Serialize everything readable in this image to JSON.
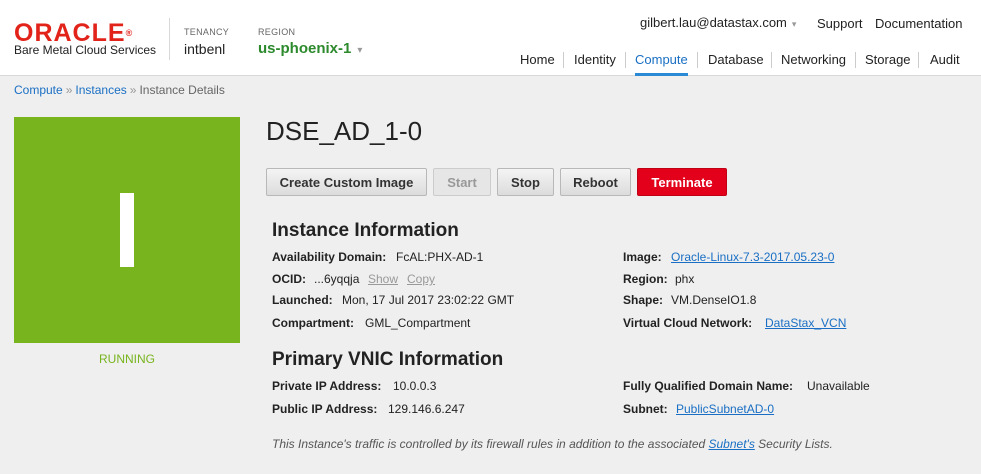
{
  "header": {
    "logo_word": "ORACLE",
    "logo_reg": "®",
    "logo_sub": "Bare Metal Cloud Services",
    "tenancy_caption": "TENANCY",
    "tenancy_value": "intbenl",
    "region_caption": "REGION",
    "region_value": "us-phoenix-1",
    "region_caret": "▾",
    "user": "gilbert.lau@datastax.com",
    "user_caret": "▾",
    "links": {
      "support": "Support",
      "documentation": "Documentation"
    },
    "nav": {
      "home": "Home",
      "identity": "Identity",
      "compute": "Compute",
      "database": "Database",
      "networking": "Networking",
      "storage": "Storage",
      "audit": "Audit"
    }
  },
  "breadcrumb": {
    "compute": "Compute",
    "instances": "Instances",
    "current": "Instance Details",
    "sep": "»"
  },
  "status": {
    "letter": "I",
    "text": "RUNNING",
    "color": "#78b41e"
  },
  "instance": {
    "title": "DSE_AD_1-0"
  },
  "actions": {
    "create_image": "Create Custom Image",
    "start": "Start",
    "stop": "Stop",
    "reboot": "Reboot",
    "terminate": "Terminate"
  },
  "instance_info": {
    "title": "Instance Information",
    "availability_domain": {
      "label": "Availability Domain:",
      "value": "FcAL:PHX-AD-1"
    },
    "ocid": {
      "label": "OCID:",
      "value": "...6yqqja",
      "show": "Show",
      "copy": "Copy"
    },
    "launched": {
      "label": "Launched:",
      "value": "Mon, 17 Jul 2017 23:02:22 GMT"
    },
    "compartment": {
      "label": "Compartment:",
      "value": "GML_Compartment"
    },
    "image": {
      "label": "Image:",
      "value": "Oracle-Linux-7.3-2017.05.23-0"
    },
    "region": {
      "label": "Region:",
      "value": "phx"
    },
    "shape": {
      "label": "Shape:",
      "value": "VM.DenseIO1.8"
    },
    "vcn": {
      "label": "Virtual Cloud Network:",
      "value": "DataStax_VCN"
    }
  },
  "vnic_info": {
    "title": "Primary VNIC Information",
    "private_ip": {
      "label": "Private IP Address:",
      "value": "10.0.0.3"
    },
    "public_ip": {
      "label": "Public IP Address:",
      "value": "129.146.6.247"
    },
    "fqdn": {
      "label": "Fully Qualified Domain Name:",
      "value": "Unavailable"
    },
    "subnet": {
      "label": "Subnet:",
      "value": "PublicSubnetAD-0"
    }
  },
  "note": {
    "before": "This Instance's traffic is controlled by its firewall rules in addition to the associated ",
    "link": "Subnet's",
    "after": " Security Lists."
  }
}
